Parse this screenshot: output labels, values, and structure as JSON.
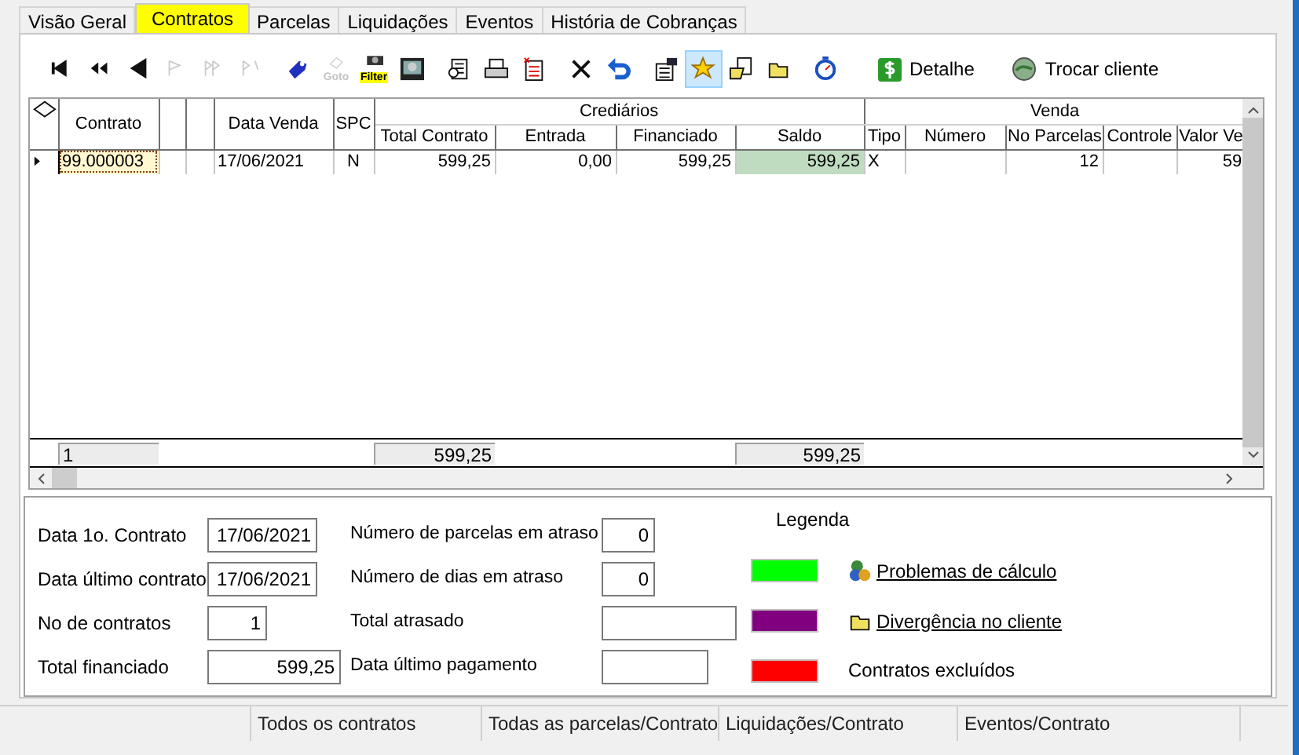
{
  "tabs": [
    {
      "label": "Visão Geral",
      "selected": false
    },
    {
      "label": "Contratos",
      "selected": true
    },
    {
      "label": "Parcelas",
      "selected": false
    },
    {
      "label": "Liquidações",
      "selected": false
    },
    {
      "label": "Eventos",
      "selected": false
    },
    {
      "label": "História de Cobranças",
      "selected": false
    }
  ],
  "toolbar": [
    {
      "kind": "first",
      "disabled": false,
      "pressed": false
    },
    {
      "kind": "prev-page",
      "disabled": false,
      "pressed": false
    },
    {
      "kind": "prev",
      "disabled": false,
      "pressed": false
    },
    {
      "kind": "next",
      "disabled": true,
      "pressed": false
    },
    {
      "kind": "next-page",
      "disabled": true,
      "pressed": false
    },
    {
      "kind": "last",
      "disabled": true,
      "pressed": false
    },
    {
      "kind": "tag",
      "disabled": false,
      "pressed": false
    },
    {
      "kind": "goto",
      "label": "Goto",
      "disabled": true,
      "pressed": false
    },
    {
      "kind": "filter",
      "label": "Filter",
      "disabled": false,
      "pressed": false
    },
    {
      "kind": "screen",
      "disabled": false,
      "pressed": false
    },
    {
      "kind": "preview",
      "disabled": false,
      "pressed": false
    },
    {
      "kind": "print",
      "disabled": false,
      "pressed": false
    },
    {
      "kind": "document",
      "disabled": false,
      "pressed": false
    },
    {
      "kind": "delete",
      "disabled": false,
      "pressed": false
    },
    {
      "kind": "undo",
      "disabled": false,
      "pressed": false
    },
    {
      "kind": "properties",
      "disabled": false,
      "pressed": false
    },
    {
      "kind": "star",
      "disabled": false,
      "pressed": true
    },
    {
      "kind": "folder-doc",
      "disabled": false,
      "pressed": false
    },
    {
      "kind": "folder",
      "disabled": false,
      "pressed": false
    },
    {
      "kind": "stopwatch",
      "disabled": false,
      "pressed": false
    },
    {
      "kind": "dollar",
      "label": "Detalhe",
      "disabled": false,
      "pressed": false
    },
    {
      "kind": "globe",
      "label": "Trocar cliente",
      "disabled": false,
      "pressed": false
    }
  ],
  "grid": {
    "column_groups": [
      "Crediários",
      "Venda"
    ],
    "columns": [
      "Contrato",
      "Data Venda",
      "SPC",
      "Total Contrato",
      "Entrada",
      "Financiado",
      "Saldo",
      "Tipo",
      "Número",
      "No Parcelas",
      "Controle",
      "Valor Ve"
    ],
    "rows": [
      {
        "current": true,
        "saldo_marked": true,
        "contrato": "99.000003",
        "data_venda": "17/06/2021",
        "spc": "N",
        "total_contrato": "599,25",
        "entrada": "0,00",
        "financiado": "599,25",
        "saldo": "599,25",
        "tipo": "X",
        "no_parcelas": "12",
        "valor_venda": "59"
      }
    ],
    "totals": {
      "count": "1",
      "total_contrato": "599,25",
      "saldo": "599,25"
    }
  },
  "summary": {
    "left": [
      {
        "label": "Data 1o. Contrato",
        "value": "17/06/2021"
      },
      {
        "label": "Data último contrato",
        "value": "17/06/2021"
      },
      {
        "label": "No de contratos",
        "value": "1"
      },
      {
        "label": "Total financiado",
        "value": "599,25"
      }
    ],
    "middle": [
      {
        "label": "Número de parcelas em atraso",
        "value": "0"
      },
      {
        "label": "Número de dias em atraso",
        "value": "0"
      },
      {
        "label": "Total atrasado"
      },
      {
        "label": "Data último pagamento"
      }
    ],
    "legend": {
      "title": "Legenda",
      "items": [
        {
          "color": "#00ff00",
          "kind": "coins",
          "label": "Problemas de cálculo"
        },
        {
          "color": "#800080",
          "kind": "folder",
          "label": "Divergência no cliente"
        },
        {
          "color": "#ff0000",
          "kind": "none",
          "label": "Contratos excluídos"
        }
      ]
    }
  },
  "status_bar": [
    "Todos os contratos",
    "Todas as parcelas/Contrato",
    "Liquidações/Contrato",
    "Eventos/Contrato"
  ]
}
